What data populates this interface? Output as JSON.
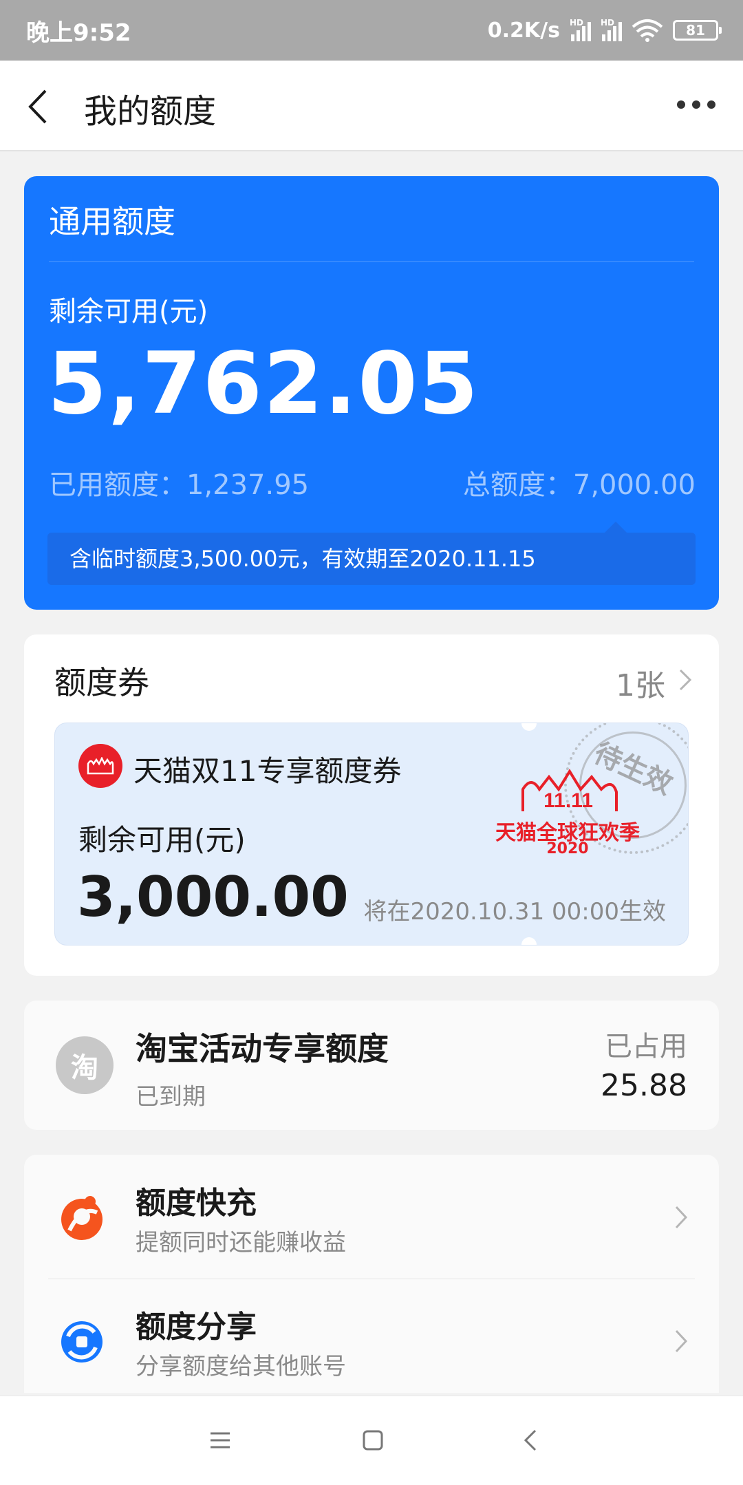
{
  "status_bar": {
    "time": "晚上9:52",
    "network_speed": "0.2K/s",
    "signal_label": "HD",
    "battery": "81"
  },
  "header": {
    "title": "我的额度",
    "back_icon": "chevron-left-icon",
    "more_icon": "more-horizontal-icon"
  },
  "general_quota": {
    "title": "通用额度",
    "available_label": "剩余可用(元)",
    "available_amount": "5,762.05",
    "used_text": "已用额度：1,237.95",
    "total_text": "总额度：7,000.00",
    "temp_notice": "含临时额度3,500.00元，有效期至2020.11.15",
    "color": "#1677ff"
  },
  "voucher_section": {
    "title": "额度券",
    "count": "1张",
    "voucher": {
      "logo_icon": "tmall-icon",
      "title": "天猫双11专享额度券",
      "available_label": "剩余可用(元)",
      "amount": "3,000.00",
      "effective_text": "将在2020.10.31 00:00生效",
      "promo_badge": "11.11",
      "promo_text": "天猫全球狂欢季",
      "promo_year": "2020",
      "stamp_text": "待生效",
      "background": "#e3eefc"
    }
  },
  "taobao_quota": {
    "logo_text": "淘",
    "title": "淘宝活动专享额度",
    "status": "已到期",
    "used_label": "已占用",
    "used_value": "25.88"
  },
  "functions": [
    {
      "icon": "quick-charge-icon",
      "title": "额度快充",
      "subtitle": "提额同时还能赚收益",
      "color": "#f5541e"
    },
    {
      "icon": "share-icon",
      "title": "额度分享",
      "subtitle": "分享额度给其他账号",
      "color": "#1677ff"
    }
  ],
  "nav_bar": {
    "menu_icon": "menu-icon",
    "home_icon": "home-square-icon",
    "back_icon": "back-triangle-icon"
  }
}
